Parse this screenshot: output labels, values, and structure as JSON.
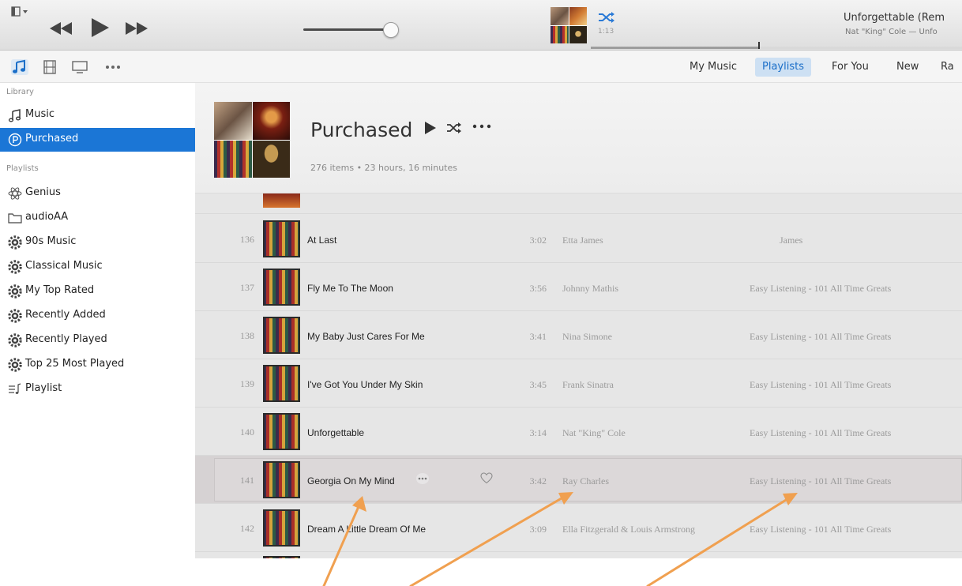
{
  "player": {
    "now_playing": {
      "time": "1:13",
      "title": "Unforgettable (Rem",
      "subtitle": "Nat \"King\" Cole — Unfo",
      "progress": 0.45
    },
    "volume": 0.9
  },
  "nav": {
    "media_icons": [
      "music-note-icon",
      "film-icon",
      "tv-icon",
      "more-dots-icon"
    ],
    "tabs": [
      {
        "label": "My Music",
        "selected": false
      },
      {
        "label": "Playlists",
        "selected": true
      },
      {
        "label": "For You",
        "selected": false
      },
      {
        "label": "New",
        "selected": false
      },
      {
        "label": "Ra",
        "selected": false
      }
    ]
  },
  "sidebar": {
    "library_heading": "Library",
    "library_items": [
      {
        "label": "Music",
        "icon": "music-note-icon",
        "selected": false
      },
      {
        "label": "Purchased",
        "icon": "purchased-icon",
        "selected": true
      }
    ],
    "playlists_heading": "Playlists",
    "playlist_items": [
      {
        "label": "Genius",
        "icon": "genius-icon"
      },
      {
        "label": "audioAA",
        "icon": "folder-icon"
      },
      {
        "label": "90s Music",
        "icon": "smart-playlist-icon"
      },
      {
        "label": "Classical Music",
        "icon": "smart-playlist-icon"
      },
      {
        "label": "My Top Rated",
        "icon": "smart-playlist-icon"
      },
      {
        "label": "Recently Added",
        "icon": "smart-playlist-icon"
      },
      {
        "label": "Recently Played",
        "icon": "smart-playlist-icon"
      },
      {
        "label": "Top 25 Most Played",
        "icon": "smart-playlist-icon"
      },
      {
        "label": "Playlist",
        "icon": "playlist-icon"
      }
    ]
  },
  "playlist": {
    "title": "Purchased",
    "meta": "276 items • 23 hours, 16 minutes",
    "tracks": [
      {
        "num": "136",
        "title": "At Last",
        "time": "3:02",
        "artist": "Etta James",
        "album": "James"
      },
      {
        "num": "137",
        "title": "Fly Me To The Moon",
        "time": "3:56",
        "artist": "Johnny Mathis",
        "album": "Easy Listening - 101 All Time Greats"
      },
      {
        "num": "138",
        "title": "My Baby Just Cares For Me",
        "time": "3:41",
        "artist": "Nina Simone",
        "album": "Easy Listening - 101 All Time Greats"
      },
      {
        "num": "139",
        "title": "I've Got You Under My Skin",
        "time": "3:45",
        "artist": "Frank Sinatra",
        "album": "Easy Listening - 101 All Time Greats"
      },
      {
        "num": "140",
        "title": "Unforgettable",
        "time": "3:14",
        "artist": "Nat \"King\" Cole",
        "album": "Easy Listening - 101 All Time Greats"
      },
      {
        "num": "141",
        "title": "Georgia On My Mind",
        "time": "3:42",
        "artist": "Ray Charles",
        "album": "Easy Listening - 101 All Time Greats",
        "selected": true
      },
      {
        "num": "142",
        "title": "Dream A Little Dream Of Me",
        "time": "3:09",
        "artist": "Ella Fitzgerald & Louis Armstrong",
        "album": "Easy Listening - 101 All Time Greats"
      }
    ]
  },
  "colors": {
    "accent": "#1b76d6",
    "tab_selected_bg": "#cde0f3",
    "tab_selected_text": "#1a6ec8",
    "annotation_arrow": "#f0a050"
  }
}
